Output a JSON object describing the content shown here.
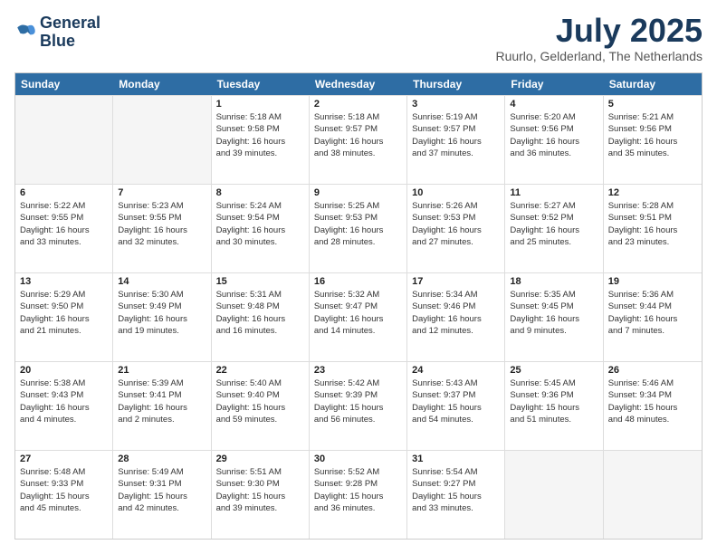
{
  "logo": {
    "line1": "General",
    "line2": "Blue"
  },
  "title": "July 2025",
  "subtitle": "Ruurlo, Gelderland, The Netherlands",
  "header_days": [
    "Sunday",
    "Monday",
    "Tuesday",
    "Wednesday",
    "Thursday",
    "Friday",
    "Saturday"
  ],
  "weeks": [
    [
      {
        "day": "",
        "content": []
      },
      {
        "day": "",
        "content": []
      },
      {
        "day": "1",
        "content": [
          "Sunrise: 5:18 AM",
          "Sunset: 9:58 PM",
          "Daylight: 16 hours",
          "and 39 minutes."
        ]
      },
      {
        "day": "2",
        "content": [
          "Sunrise: 5:18 AM",
          "Sunset: 9:57 PM",
          "Daylight: 16 hours",
          "and 38 minutes."
        ]
      },
      {
        "day": "3",
        "content": [
          "Sunrise: 5:19 AM",
          "Sunset: 9:57 PM",
          "Daylight: 16 hours",
          "and 37 minutes."
        ]
      },
      {
        "day": "4",
        "content": [
          "Sunrise: 5:20 AM",
          "Sunset: 9:56 PM",
          "Daylight: 16 hours",
          "and 36 minutes."
        ]
      },
      {
        "day": "5",
        "content": [
          "Sunrise: 5:21 AM",
          "Sunset: 9:56 PM",
          "Daylight: 16 hours",
          "and 35 minutes."
        ]
      }
    ],
    [
      {
        "day": "6",
        "content": [
          "Sunrise: 5:22 AM",
          "Sunset: 9:55 PM",
          "Daylight: 16 hours",
          "and 33 minutes."
        ]
      },
      {
        "day": "7",
        "content": [
          "Sunrise: 5:23 AM",
          "Sunset: 9:55 PM",
          "Daylight: 16 hours",
          "and 32 minutes."
        ]
      },
      {
        "day": "8",
        "content": [
          "Sunrise: 5:24 AM",
          "Sunset: 9:54 PM",
          "Daylight: 16 hours",
          "and 30 minutes."
        ]
      },
      {
        "day": "9",
        "content": [
          "Sunrise: 5:25 AM",
          "Sunset: 9:53 PM",
          "Daylight: 16 hours",
          "and 28 minutes."
        ]
      },
      {
        "day": "10",
        "content": [
          "Sunrise: 5:26 AM",
          "Sunset: 9:53 PM",
          "Daylight: 16 hours",
          "and 27 minutes."
        ]
      },
      {
        "day": "11",
        "content": [
          "Sunrise: 5:27 AM",
          "Sunset: 9:52 PM",
          "Daylight: 16 hours",
          "and 25 minutes."
        ]
      },
      {
        "day": "12",
        "content": [
          "Sunrise: 5:28 AM",
          "Sunset: 9:51 PM",
          "Daylight: 16 hours",
          "and 23 minutes."
        ]
      }
    ],
    [
      {
        "day": "13",
        "content": [
          "Sunrise: 5:29 AM",
          "Sunset: 9:50 PM",
          "Daylight: 16 hours",
          "and 21 minutes."
        ]
      },
      {
        "day": "14",
        "content": [
          "Sunrise: 5:30 AM",
          "Sunset: 9:49 PM",
          "Daylight: 16 hours",
          "and 19 minutes."
        ]
      },
      {
        "day": "15",
        "content": [
          "Sunrise: 5:31 AM",
          "Sunset: 9:48 PM",
          "Daylight: 16 hours",
          "and 16 minutes."
        ]
      },
      {
        "day": "16",
        "content": [
          "Sunrise: 5:32 AM",
          "Sunset: 9:47 PM",
          "Daylight: 16 hours",
          "and 14 minutes."
        ]
      },
      {
        "day": "17",
        "content": [
          "Sunrise: 5:34 AM",
          "Sunset: 9:46 PM",
          "Daylight: 16 hours",
          "and 12 minutes."
        ]
      },
      {
        "day": "18",
        "content": [
          "Sunrise: 5:35 AM",
          "Sunset: 9:45 PM",
          "Daylight: 16 hours",
          "and 9 minutes."
        ]
      },
      {
        "day": "19",
        "content": [
          "Sunrise: 5:36 AM",
          "Sunset: 9:44 PM",
          "Daylight: 16 hours",
          "and 7 minutes."
        ]
      }
    ],
    [
      {
        "day": "20",
        "content": [
          "Sunrise: 5:38 AM",
          "Sunset: 9:43 PM",
          "Daylight: 16 hours",
          "and 4 minutes."
        ]
      },
      {
        "day": "21",
        "content": [
          "Sunrise: 5:39 AM",
          "Sunset: 9:41 PM",
          "Daylight: 16 hours",
          "and 2 minutes."
        ]
      },
      {
        "day": "22",
        "content": [
          "Sunrise: 5:40 AM",
          "Sunset: 9:40 PM",
          "Daylight: 15 hours",
          "and 59 minutes."
        ]
      },
      {
        "day": "23",
        "content": [
          "Sunrise: 5:42 AM",
          "Sunset: 9:39 PM",
          "Daylight: 15 hours",
          "and 56 minutes."
        ]
      },
      {
        "day": "24",
        "content": [
          "Sunrise: 5:43 AM",
          "Sunset: 9:37 PM",
          "Daylight: 15 hours",
          "and 54 minutes."
        ]
      },
      {
        "day": "25",
        "content": [
          "Sunrise: 5:45 AM",
          "Sunset: 9:36 PM",
          "Daylight: 15 hours",
          "and 51 minutes."
        ]
      },
      {
        "day": "26",
        "content": [
          "Sunrise: 5:46 AM",
          "Sunset: 9:34 PM",
          "Daylight: 15 hours",
          "and 48 minutes."
        ]
      }
    ],
    [
      {
        "day": "27",
        "content": [
          "Sunrise: 5:48 AM",
          "Sunset: 9:33 PM",
          "Daylight: 15 hours",
          "and 45 minutes."
        ]
      },
      {
        "day": "28",
        "content": [
          "Sunrise: 5:49 AM",
          "Sunset: 9:31 PM",
          "Daylight: 15 hours",
          "and 42 minutes."
        ]
      },
      {
        "day": "29",
        "content": [
          "Sunrise: 5:51 AM",
          "Sunset: 9:30 PM",
          "Daylight: 15 hours",
          "and 39 minutes."
        ]
      },
      {
        "day": "30",
        "content": [
          "Sunrise: 5:52 AM",
          "Sunset: 9:28 PM",
          "Daylight: 15 hours",
          "and 36 minutes."
        ]
      },
      {
        "day": "31",
        "content": [
          "Sunrise: 5:54 AM",
          "Sunset: 9:27 PM",
          "Daylight: 15 hours",
          "and 33 minutes."
        ]
      },
      {
        "day": "",
        "content": []
      },
      {
        "day": "",
        "content": []
      }
    ]
  ]
}
